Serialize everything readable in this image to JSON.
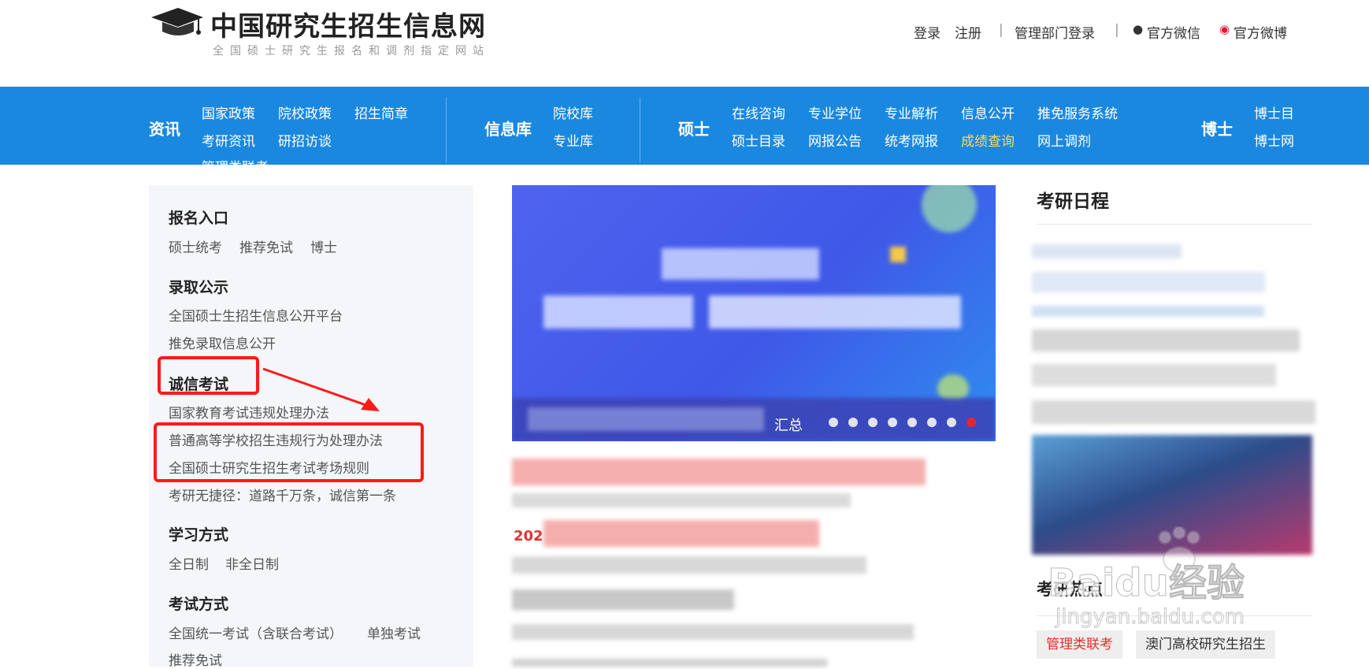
{
  "header": {
    "logo_title": "中国研究生招生信息网",
    "logo_subtitle": "全国硕士研究生报名和调剂指定网站",
    "links": {
      "login": "登录",
      "register": "注册",
      "sep1": "|",
      "admin_login": "管理部门登录",
      "sep2": "|",
      "wechat": "官方微信",
      "weibo": "官方微博"
    }
  },
  "nav": {
    "zixun": {
      "label": "资讯",
      "items": [
        "国家政策",
        "院校政策",
        "招生简章",
        "考研资讯",
        "研招访谈",
        "管理类联考"
      ]
    },
    "xinxiku": {
      "label": "信息库",
      "items": [
        "院校库",
        "专业库"
      ]
    },
    "shuoshi": {
      "label": "硕士",
      "items": [
        "在线咨询",
        "专业学位",
        "专业解析",
        "信息公开",
        "推免服务系统",
        "硕士目录",
        "网报公告",
        "统考网报",
        "成绩查询",
        "网上调剂"
      ]
    },
    "boshi": {
      "label": "博士",
      "items": [
        "博士目",
        "博士网"
      ]
    }
  },
  "sidebar": {
    "sections": [
      {
        "title": "报名入口",
        "links": [
          "硕士统考",
          "推荐免试",
          "博士"
        ]
      },
      {
        "title": "录取公示",
        "links": [
          "全国硕士生招生信息公开平台",
          "推免录取信息公开"
        ]
      },
      {
        "title": "诚信考试",
        "links": [
          "国家教育考试违规处理办法",
          "普通高等学校招生违规行为处理办法",
          "全国硕士研究生招生考试考场规则",
          "考研无捷径：道路千万条，诚信第一条"
        ]
      },
      {
        "title": "学习方式",
        "links": [
          "全日制",
          "非全日制"
        ]
      },
      {
        "title": "考试方式",
        "links": [
          "全国统一考试（含联合考试）",
          "单独考试",
          "推荐免试"
        ]
      }
    ]
  },
  "banner": {
    "caption_tail": "汇总",
    "dot_count": 8,
    "active_dot": 7
  },
  "news": {
    "year_fragment": "202"
  },
  "right": {
    "schedule_title": "考研日程",
    "hot_title": "考研热点",
    "tags": [
      "管理类联考",
      "澳门高校研究生招生"
    ]
  },
  "watermark": {
    "brand": "Baidu经验",
    "url": "jingyan.baidu.com"
  },
  "colors": {
    "nav_bg": "#1b88e0",
    "nav_highlight": "#ffd95a",
    "annotation_red": "#ff1a1a",
    "tag_red": "#e0322f"
  }
}
